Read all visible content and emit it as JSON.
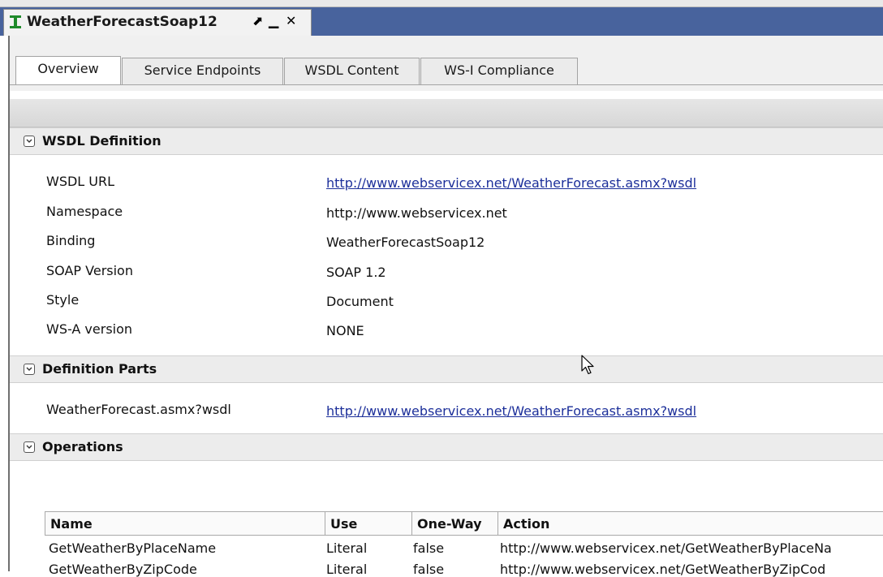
{
  "editor": {
    "title": "WeatherForecastSoap12",
    "controls": {
      "maximize": "⬈",
      "minimize": "▁",
      "close": "✕"
    }
  },
  "tabs": [
    {
      "label": "Overview",
      "active": true
    },
    {
      "label": "Service Endpoints",
      "active": false
    },
    {
      "label": "WSDL Content",
      "active": false
    },
    {
      "label": "WS-I Compliance",
      "active": false
    }
  ],
  "wsdl_definition": {
    "title": "WSDL Definition",
    "rows": [
      {
        "label": "WSDL URL",
        "value": "http://www.webservicex.net/WeatherForecast.asmx?wsdl",
        "link": true
      },
      {
        "label": "Namespace",
        "value": "http://www.webservicex.net",
        "link": false
      },
      {
        "label": "Binding",
        "value": "WeatherForecastSoap12",
        "link": false
      },
      {
        "label": "SOAP Version",
        "value": "SOAP 1.2",
        "link": false
      },
      {
        "label": "Style",
        "value": "Document",
        "link": false
      },
      {
        "label": "WS-A version",
        "value": "NONE",
        "link": false
      }
    ]
  },
  "definition_parts": {
    "title": "Definition Parts",
    "rows": [
      {
        "label": "WeatherForecast.asmx?wsdl",
        "value": "http://www.webservicex.net/WeatherForecast.asmx?wsdl",
        "link": true
      }
    ]
  },
  "operations": {
    "title": "Operations",
    "columns": [
      "Name",
      "Use",
      "One-Way",
      "Action"
    ],
    "rows": [
      [
        "GetWeatherByPlaceName",
        "Literal",
        "false",
        "http://www.webservicex.net/GetWeatherByPlaceNa"
      ],
      [
        "GetWeatherByZipCode",
        "Literal",
        "false",
        "http://www.webservicex.net/GetWeatherByZipCod"
      ]
    ]
  },
  "icons": {
    "view": "soapui-interface-icon",
    "collapse": "chevron-down-icon",
    "cursor": "mouse-pointer-icon"
  },
  "colors": {
    "titlebar": "#48639d",
    "link": "#1c2f9a",
    "icon": "#1f8a2a"
  }
}
